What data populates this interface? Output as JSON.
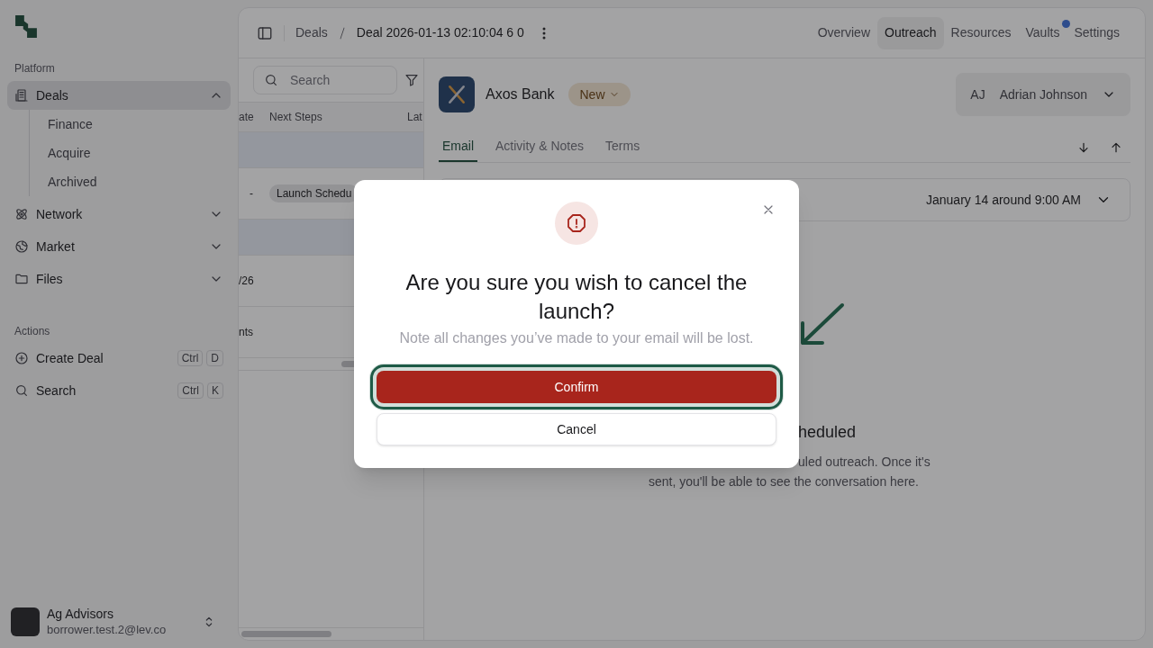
{
  "sidebar": {
    "sections": [
      {
        "heading": "Platform",
        "items": [
          {
            "label": "Deals",
            "selected": true,
            "expanded": true,
            "children": [
              {
                "label": "Finance"
              },
              {
                "label": "Acquire"
              },
              {
                "label": "Archived"
              }
            ]
          },
          {
            "label": "Network",
            "selected": false,
            "expanded": false
          },
          {
            "label": "Market",
            "selected": false,
            "expanded": false
          },
          {
            "label": "Files",
            "selected": false,
            "expanded": false
          }
        ]
      },
      {
        "heading": "Actions",
        "items": [
          {
            "label": "Create Deal",
            "keys": [
              "Ctrl",
              "D"
            ]
          },
          {
            "label": "Search",
            "keys": [
              "Ctrl",
              "K"
            ]
          }
        ]
      }
    ],
    "account": {
      "name": "Ag Advisors",
      "email": "borrower.test.2@lev.co"
    }
  },
  "header": {
    "breadcrumb": [
      "Deals",
      "Deal 2026-01-13 02:10:04 6 0"
    ],
    "tabs": [
      {
        "label": "Overview",
        "selected": false,
        "notification": false
      },
      {
        "label": "Outreach",
        "selected": true,
        "notification": false
      },
      {
        "label": "Resources",
        "selected": false,
        "notification": false
      },
      {
        "label": "Vaults",
        "selected": false,
        "notification": true
      },
      {
        "label": "Settings",
        "selected": false,
        "notification": false
      }
    ]
  },
  "deal_list": {
    "search": {
      "placeholder": "Search"
    },
    "columns": [
      "ate",
      "Next Steps",
      "Lat"
    ],
    "rows": [
      {
        "highlighted": true
      },
      {
        "highlighted": false,
        "column_1": "-",
        "next_steps": "Launch Schedu"
      },
      {
        "highlighted": true
      },
      {
        "highlighted": false,
        "column_1": "/26"
      },
      {
        "highlighted": false,
        "column_1": "nts"
      }
    ]
  },
  "detail": {
    "company": {
      "name": "Axos Bank",
      "status": "New"
    },
    "assignee": {
      "initials": "AJ",
      "name": "Adrian Johnson"
    },
    "tabs": [
      {
        "label": "Email",
        "selected": true
      },
      {
        "label": "Activity & Notes",
        "selected": false
      },
      {
        "label": "Terms",
        "selected": false
      }
    ],
    "schedule": {
      "time": "January 14 around 9:00 AM"
    },
    "empty_state": {
      "title": "heduled",
      "lines": [
        "uled outreach. Once it's",
        "sent, you'll be able to see the conversation here."
      ]
    }
  },
  "dialog": {
    "title": "Are you sure you wish to cancel the launch?",
    "message": "Note all changes you’ve made to your email will be lost.",
    "buttons": [
      {
        "label": "Confirm",
        "kind": "danger",
        "focused": true
      },
      {
        "label": "Cancel",
        "kind": "secondary",
        "focused": false
      }
    ]
  }
}
